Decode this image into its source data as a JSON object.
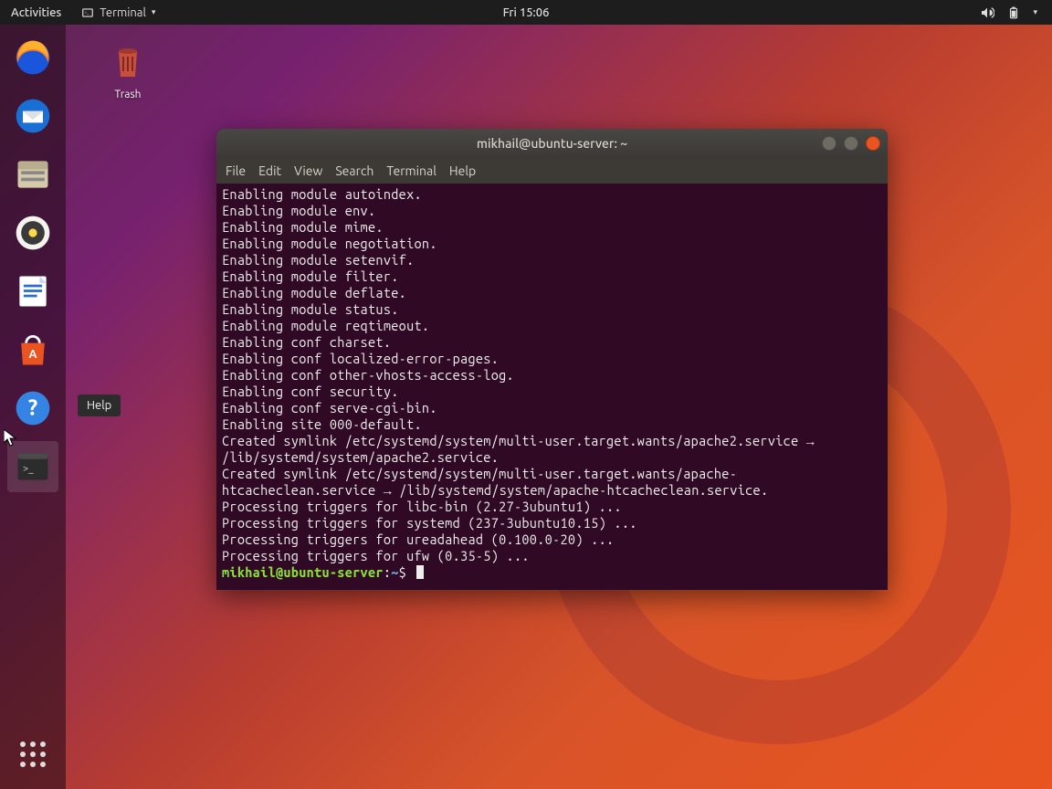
{
  "topbar": {
    "activities": "Activities",
    "appmenu_label": "Terminal",
    "clock": "Fri 15:06"
  },
  "desktop": {
    "trash_label": "Trash"
  },
  "tooltip": "Help",
  "terminal": {
    "title": "mikhail@ubuntu-server: ~",
    "menu": {
      "file": "File",
      "edit": "Edit",
      "view": "View",
      "search": "Search",
      "terminal": "Terminal",
      "help": "Help"
    },
    "lines": [
      "Enabling module autoindex.",
      "Enabling module env.",
      "Enabling module mime.",
      "Enabling module negotiation.",
      "Enabling module setenvif.",
      "Enabling module filter.",
      "Enabling module deflate.",
      "Enabling module status.",
      "Enabling module reqtimeout.",
      "Enabling conf charset.",
      "Enabling conf localized-error-pages.",
      "Enabling conf other-vhosts-access-log.",
      "Enabling conf security.",
      "Enabling conf serve-cgi-bin.",
      "Enabling site 000-default.",
      "Created symlink /etc/systemd/system/multi-user.target.wants/apache2.service → /lib/systemd/system/apache2.service.",
      "Created symlink /etc/systemd/system/multi-user.target.wants/apache-htcacheclean.service → /lib/systemd/system/apache-htcacheclean.service.",
      "Processing triggers for libc-bin (2.27-3ubuntu1) ...",
      "Processing triggers for systemd (237-3ubuntu10.15) ...",
      "Processing triggers for ureadahead (0.100.0-20) ...",
      "Processing triggers for ufw (0.35-5) ..."
    ],
    "prompt_user": "mikhail@ubuntu-server",
    "prompt_colon": ":",
    "prompt_path": "~",
    "prompt_dollar": "$"
  }
}
